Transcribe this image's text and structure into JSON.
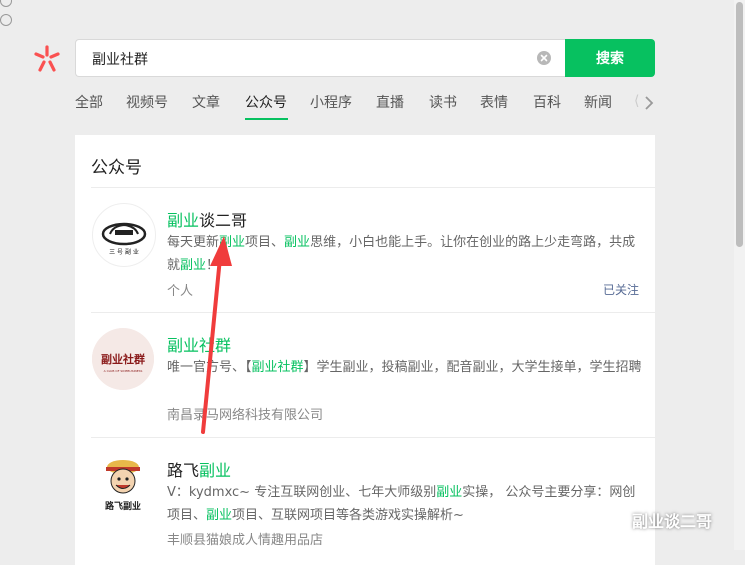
{
  "search": {
    "query": "副业社群",
    "button_label": "搜索"
  },
  "tabs": [
    {
      "label": "全部",
      "active": false
    },
    {
      "label": "视频号",
      "active": false
    },
    {
      "label": "文章",
      "active": false
    },
    {
      "label": "公众号",
      "active": true
    },
    {
      "label": "小程序",
      "active": false
    },
    {
      "label": "直播",
      "active": false
    },
    {
      "label": "读书",
      "active": false
    },
    {
      "label": "表情",
      "active": false
    },
    {
      "label": "百科",
      "active": false
    },
    {
      "label": "新闻",
      "active": false
    }
  ],
  "panel": {
    "title": "公众号"
  },
  "results": [
    {
      "title_hl": "副业",
      "title_rest": "谈二哥",
      "desc_parts": [
        "每天更新",
        "副业",
        "项目、",
        "副业",
        "思维，小白也能上手。让你在创业的路上少走弯路，共",
        "成就",
        "副业",
        "！"
      ],
      "meta": "个人",
      "followed": "已关注"
    },
    {
      "title_hl": "副业社群",
      "desc_parts": [
        "唯一官方号、【",
        "副业社群",
        "】学生副业，投稿副业，配音副业，大学生接单，学生招聘"
      ],
      "meta": "南昌录马网络科技有限公司"
    },
    {
      "title_rest_pre": "路飞",
      "title_hl": "副业",
      "desc_parts": [
        "V：kydmxc~ 专注互联网创业、七年大师级别",
        "副业",
        "实操， 公众号主要分享：网创项目、",
        "副业",
        "项目、互联网项目等各类游戏实操解析~"
      ],
      "meta": "丰顺县猫娘成人情趣用品店"
    }
  ],
  "avatars": {
    "a2_text": "副业社群",
    "a2_sub": "A CLUB OF SIDEBUSINESS",
    "a3_text": "路飞副业"
  },
  "watermark": {
    "text": "副业谈二哥"
  },
  "colors": {
    "accent": "#07c160",
    "link": "#576b95",
    "logo": "#fa5151"
  }
}
